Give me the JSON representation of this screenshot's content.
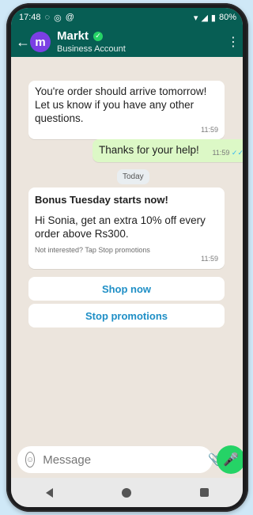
{
  "status": {
    "time": "17:48",
    "battery": "80%"
  },
  "header": {
    "back_icon": "back-arrow-icon",
    "avatar_letter": "m",
    "name": "Markt",
    "subtitle": "Business Account"
  },
  "messages": {
    "incoming_1": {
      "text": "You're order should arrive tomorrow! Let us know if you have any other questions.",
      "time": "11:59"
    },
    "outgoing_1": {
      "text": "Thanks for your help!",
      "time": "11:59"
    },
    "date_separator": "Today",
    "incoming_2": {
      "title": "Bonus Tuesday starts now!",
      "body": "Hi Sonia, get an extra 10% off every order above Rs300.",
      "footer": "Not interested? Tap Stop promotions",
      "time": "11:59"
    }
  },
  "actions": {
    "shop_now": "Shop now",
    "stop_promotions": "Stop promotions"
  },
  "composer": {
    "placeholder": "Message"
  },
  "colors": {
    "header": "#075e54",
    "accent_green": "#25d366",
    "link_blue": "#1f8fc6"
  }
}
